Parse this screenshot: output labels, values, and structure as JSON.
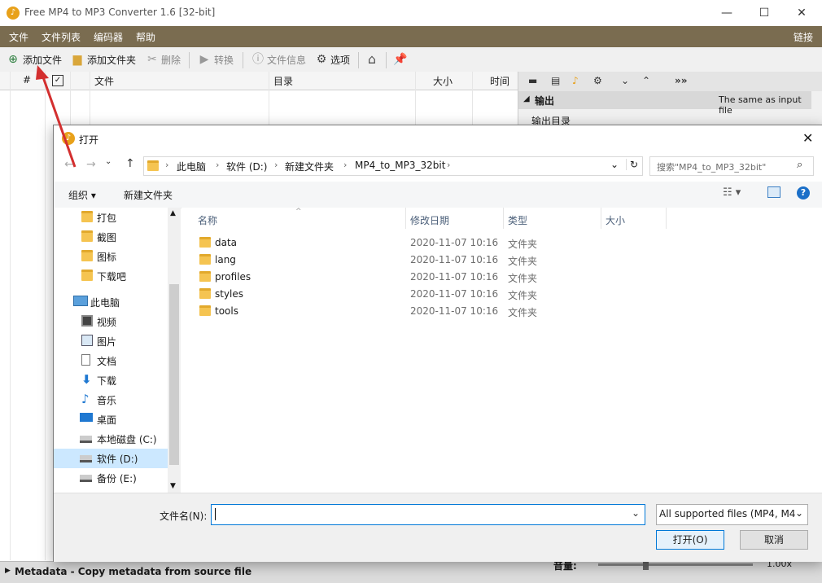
{
  "app": {
    "title": "Free MP4 to MP3 Converter 1.6  [32-bit]",
    "icon_letter": "♪",
    "menu": [
      "文件",
      "文件列表",
      "编码器",
      "帮助"
    ],
    "menu_right": "链接",
    "toolbar": {
      "add_file": "添加文件",
      "add_folder": "添加文件夹",
      "delete": "删除",
      "convert": "转换",
      "file_info": "文件信息",
      "options": "选项"
    },
    "table_headers": {
      "num": "#",
      "file": "文件",
      "dir": "目录",
      "size": "大小",
      "time": "时间"
    },
    "right_panel": {
      "output_header": "输出",
      "output_value": "The same as input file",
      "output_dir": "输出目录",
      "more": "»»"
    },
    "status": {
      "metadata": "Metadata - Copy metadata from source file",
      "volume_label": "音量:",
      "volume_value": "1.00x"
    }
  },
  "dialog": {
    "title": "打开",
    "address": [
      "此电脑",
      "软件 (D:)",
      "新建文件夹",
      "MP4_to_MP3_32bit"
    ],
    "search_placeholder": "搜索\"MP4_to_MP3_32bit\"",
    "organize": "组织 ▾",
    "new_folder": "新建文件夹",
    "nav_items": [
      {
        "label": "打包",
        "icon": "folder-icon"
      },
      {
        "label": "截图",
        "icon": "folder-icon"
      },
      {
        "label": "图标",
        "icon": "folder-icon"
      },
      {
        "label": "下载吧",
        "icon": "folder-icon"
      },
      {
        "label": "此电脑",
        "icon": "computer-icon"
      },
      {
        "label": "视频",
        "icon": "video-icon"
      },
      {
        "label": "图片",
        "icon": "picture-icon"
      },
      {
        "label": "文档",
        "icon": "document-icon"
      },
      {
        "label": "下载",
        "icon": "download-icon"
      },
      {
        "label": "音乐",
        "icon": "music-icon"
      },
      {
        "label": "桌面",
        "icon": "desktop-icon"
      },
      {
        "label": "本地磁盘 (C:)",
        "icon": "drive-icon"
      },
      {
        "label": "软件 (D:)",
        "icon": "drive-icon"
      },
      {
        "label": "备份 (E:)",
        "icon": "drive-icon"
      }
    ],
    "columns": {
      "name": "名称",
      "date": "修改日期",
      "type": "类型",
      "size": "大小"
    },
    "files": [
      {
        "name": "data",
        "date": "2020-11-07 10:16",
        "type": "文件夹"
      },
      {
        "name": "lang",
        "date": "2020-11-07 10:16",
        "type": "文件夹"
      },
      {
        "name": "profiles",
        "date": "2020-11-07 10:16",
        "type": "文件夹"
      },
      {
        "name": "styles",
        "date": "2020-11-07 10:16",
        "type": "文件夹"
      },
      {
        "name": "tools",
        "date": "2020-11-07 10:16",
        "type": "文件夹"
      }
    ],
    "filename_label": "文件名(N):",
    "filename_value": "",
    "filter": "All supported files (MP4, M4",
    "open_button": "打开(O)",
    "cancel_button": "取消"
  },
  "colors": {
    "menubar": "#7a6c50",
    "accent": "#0078d7",
    "arrow": "#d32f2f"
  }
}
